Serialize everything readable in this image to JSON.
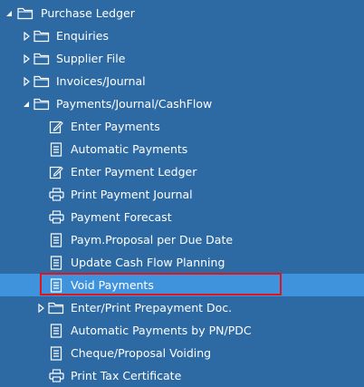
{
  "tree": {
    "root": {
      "label": "Purchase Ledger",
      "expanded": true,
      "icon": "folder-icon"
    },
    "folders": [
      {
        "label": "Enquiries",
        "expanded": false,
        "icon": "folder-icon"
      },
      {
        "label": "Supplier File",
        "expanded": false,
        "icon": "folder-icon"
      },
      {
        "label": "Invoices/Journal",
        "expanded": false,
        "icon": "folder-icon"
      },
      {
        "label": "Payments/Journal/CashFlow",
        "expanded": true,
        "icon": "folder-icon"
      }
    ],
    "payments_items": [
      {
        "label": "Enter Payments",
        "icon": "edit-icon"
      },
      {
        "label": "Automatic Payments",
        "icon": "list-icon"
      },
      {
        "label": "Enter Payment Ledger",
        "icon": "edit-icon"
      },
      {
        "label": "Print Payment Journal",
        "icon": "printer-icon"
      },
      {
        "label": "Payment Forecast",
        "icon": "printer-icon"
      },
      {
        "label": "Paym.Proposal per Due Date",
        "icon": "list-icon"
      },
      {
        "label": "Update Cash Flow Planning",
        "icon": "list-icon"
      },
      {
        "label": "Void Payments",
        "icon": "list-icon",
        "selected": true
      },
      {
        "label": "Enter/Print Prepayment Doc.",
        "icon": "folder-icon",
        "expandable": true
      },
      {
        "label": "Automatic Payments by PN/PDC",
        "icon": "list-icon"
      },
      {
        "label": "Cheque/Proposal Voiding",
        "icon": "list-icon"
      },
      {
        "label": "Print Tax Certificate",
        "icon": "printer-icon"
      }
    ]
  },
  "colors": {
    "background": "#2d6aa3",
    "selected_background": "#3f93dc",
    "highlight_border": "#e0141c",
    "text": "#ffffff"
  }
}
